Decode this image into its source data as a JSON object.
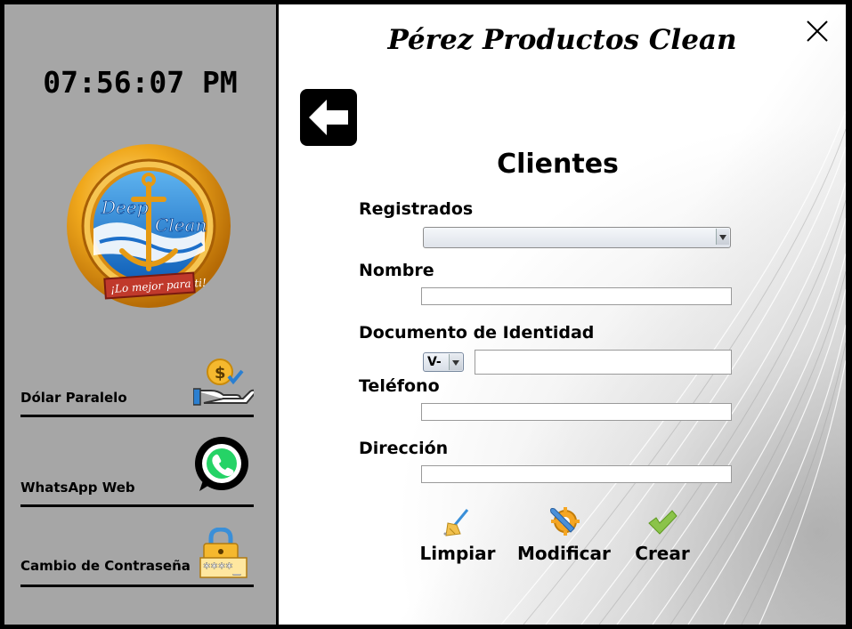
{
  "sidebar": {
    "clock": "07:56:07 PM",
    "logo": {
      "text_top": "Deep",
      "text_bottom": "Clean",
      "tagline": "¡Lo mejor para ti!"
    },
    "items": [
      {
        "label": "Dólar Paralelo",
        "icon": "dollar-hand-icon"
      },
      {
        "label": "WhatsApp Web",
        "icon": "whatsapp-icon"
      },
      {
        "label": "Cambio de Contraseña",
        "icon": "password-lock-icon",
        "icon_text": "****_"
      }
    ]
  },
  "header": {
    "title": "Pérez Productos Clean"
  },
  "form": {
    "heading": "Clientes",
    "registrados_label": "Registrados",
    "registrados_value": "",
    "nombre_label": "Nombre",
    "nombre_value": "",
    "documento_label": "Documento de Identidad",
    "documento_prefix": "V-",
    "documento_value": "",
    "telefono_label": "Teléfono",
    "telefono_value": "",
    "direccion_label": "Dirección",
    "direccion_value": ""
  },
  "actions": {
    "limpiar": "Limpiar",
    "modificar": "Modificar",
    "crear": "Crear"
  },
  "colors": {
    "sidebar_bg": "#a6a6a6",
    "border": "#000000",
    "whatsapp": "#25d366",
    "gold": "#e8a21c",
    "check_green": "#8bc34a"
  }
}
